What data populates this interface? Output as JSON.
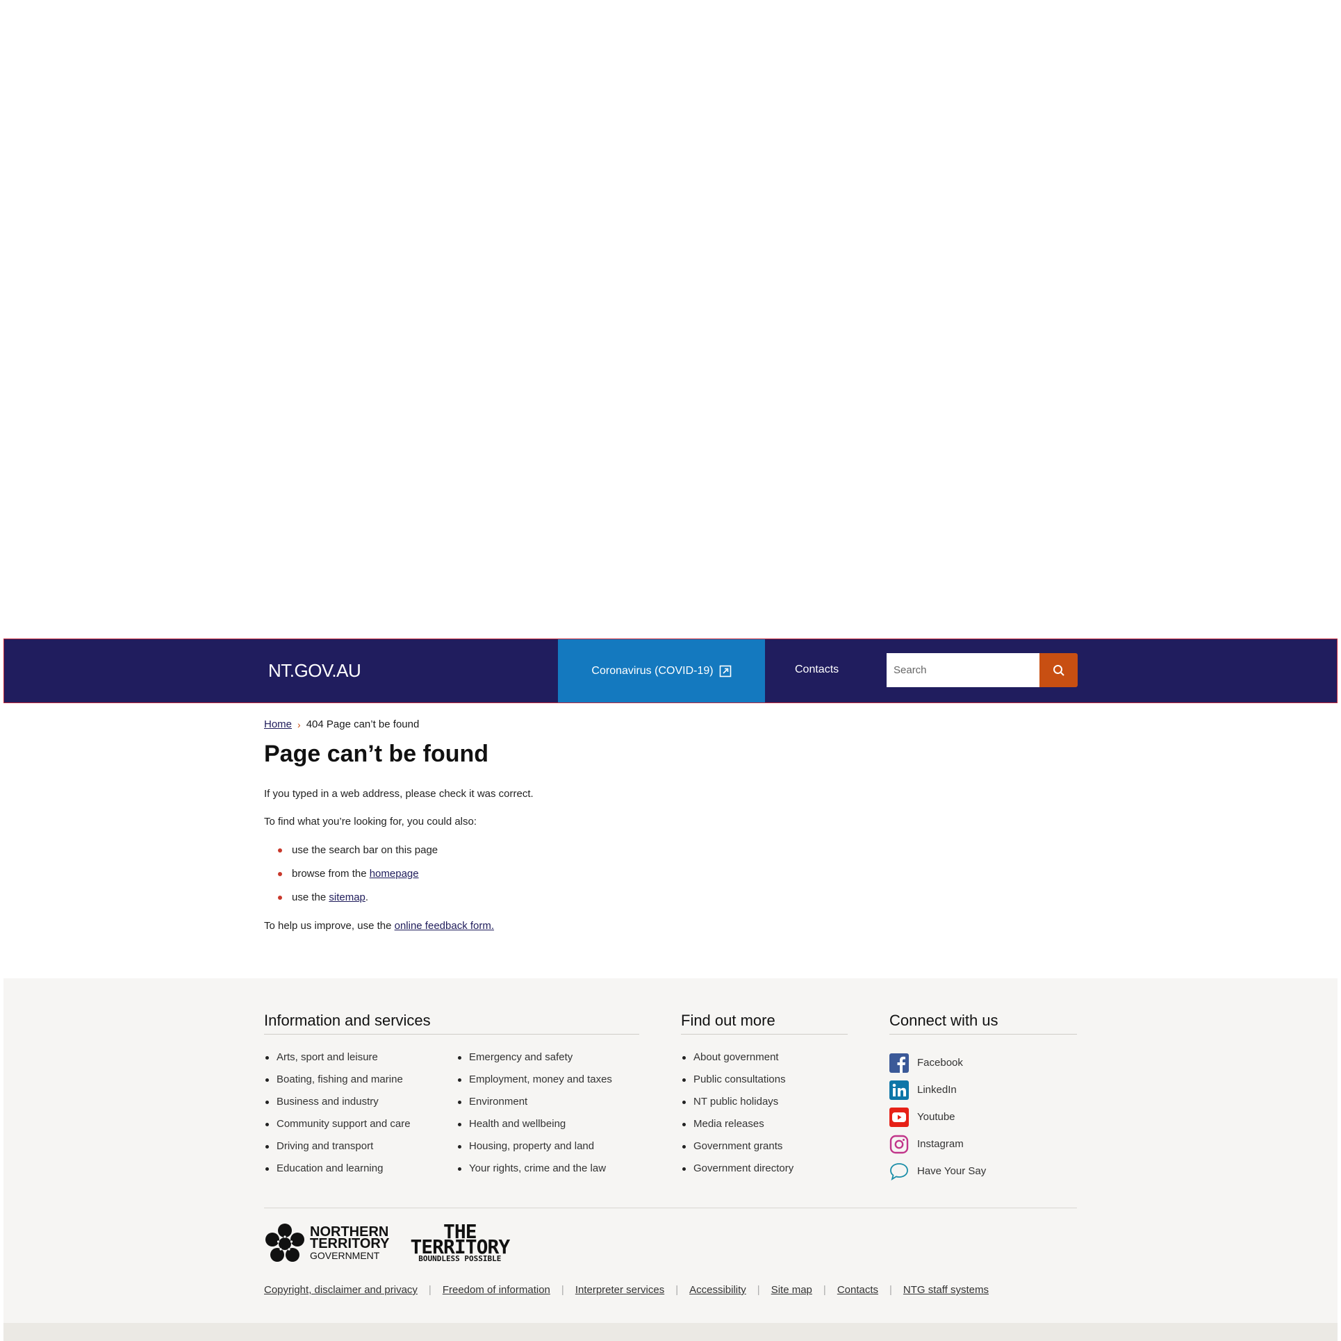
{
  "header": {
    "logo": "NT.GOV.AU",
    "covid_link": "Coronavirus (COVID-19)",
    "contacts_link": "Contacts",
    "search_placeholder": "Search"
  },
  "breadcrumb": {
    "home": "Home",
    "current": "404 Page can’t be found"
  },
  "page": {
    "title": "Page can’t be found",
    "intro": "If you typed in a web address, please check it was correct.",
    "find_text": "To find what you’re looking for, you could also:",
    "bullets": [
      {
        "text": "use the search bar on this page"
      },
      {
        "prefix": "browse from the ",
        "link": "homepage"
      },
      {
        "prefix": "use the ",
        "link": "sitemap",
        "suffix": "."
      }
    ],
    "feedback_prefix": "To help us improve, use the ",
    "feedback_link": "online feedback form."
  },
  "footer": {
    "info_title": "Information and services",
    "info_col1": [
      "Arts, sport and leisure",
      "Boating, fishing and marine",
      "Business and industry",
      "Community support and care",
      "Driving and transport",
      "Education and learning"
    ],
    "info_col2": [
      "Emergency and safety",
      "Employment, money and taxes",
      "Environment",
      "Health and wellbeing",
      "Housing, property and land",
      "Your rights, crime and the law"
    ],
    "find_title": "Find out more",
    "find_items": [
      "About government",
      "Public consultations",
      "NT public holidays",
      "Media releases",
      "Government grants",
      "Government directory"
    ],
    "connect_title": "Connect with us",
    "social": [
      {
        "label": "Facebook",
        "icon": "facebook-icon"
      },
      {
        "label": "LinkedIn",
        "icon": "linkedin-icon"
      },
      {
        "label": "Youtube",
        "icon": "youtube-icon"
      },
      {
        "label": "Instagram",
        "icon": "instagram-icon"
      },
      {
        "label": "Have Your Say",
        "icon": "speech-bubble-icon"
      }
    ],
    "ntg_logo_lines": [
      "NORTHERN",
      "TERRITORY",
      "GOVERNMENT"
    ],
    "territory_logo_lines": [
      "THE",
      "TERRITORY",
      "BOUNDLESS POSSIBLE"
    ],
    "legal_links": [
      "Copyright, disclaimer and privacy",
      "Freedom of information",
      "Interpreter services",
      "Accessibility",
      "Site map",
      "Contacts",
      "NTG staff systems"
    ]
  },
  "colors": {
    "header_bg": "#201d5e",
    "covid_bg": "#1479bf",
    "search_button": "#c84f12",
    "bullet": "#c8382b",
    "footer_bg": "#f6f5f3"
  }
}
